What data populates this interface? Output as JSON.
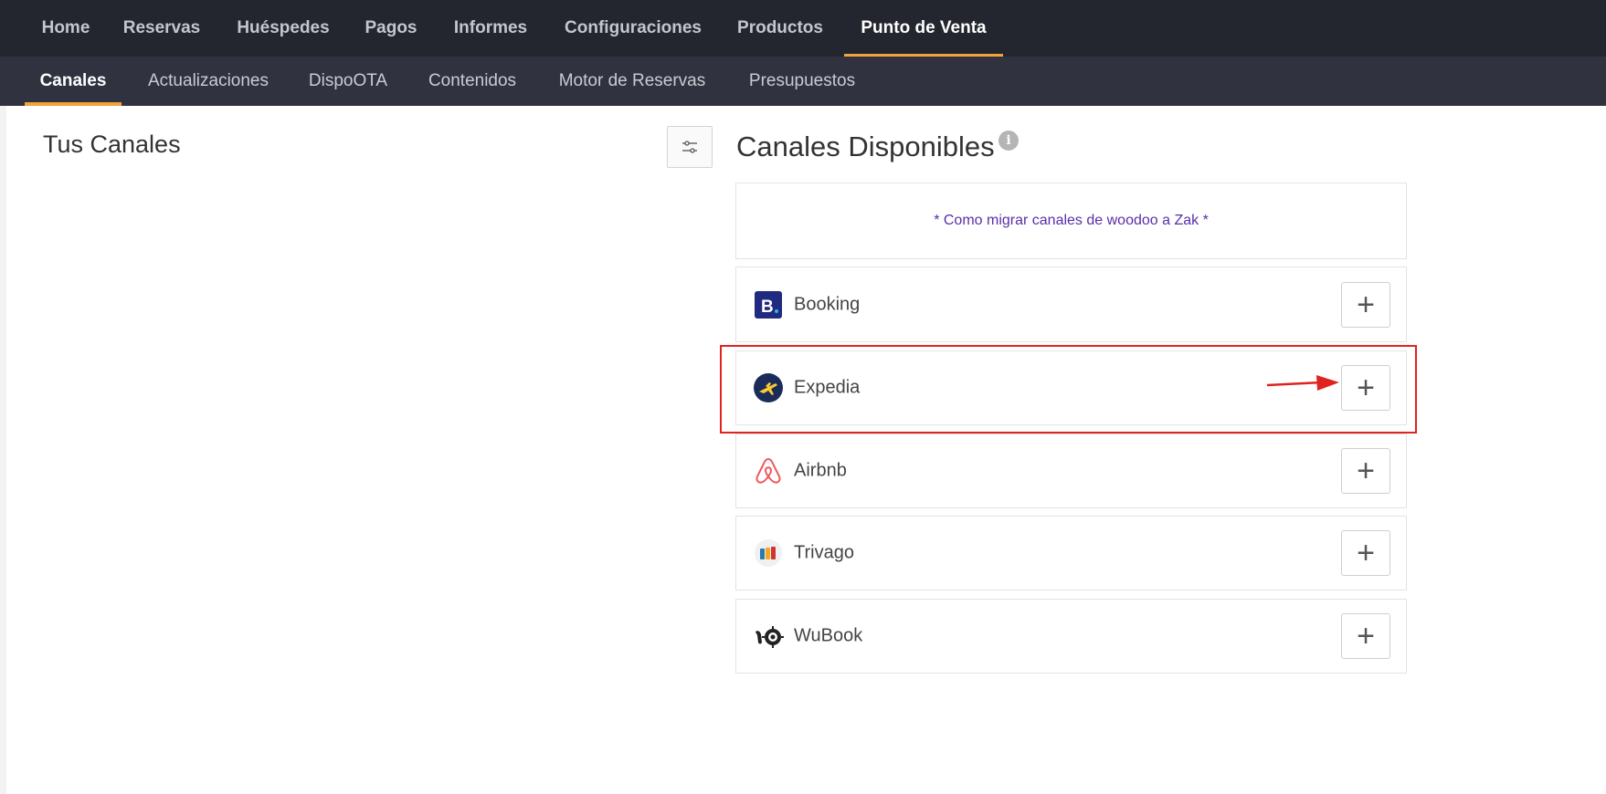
{
  "topnav": {
    "items": [
      {
        "label": "Home",
        "active": false
      },
      {
        "label": "Reservas",
        "active": false
      },
      {
        "label": "Huéspedes",
        "active": false
      },
      {
        "label": "Pagos",
        "active": false
      },
      {
        "label": "Informes",
        "active": false
      },
      {
        "label": "Configuraciones",
        "active": false
      },
      {
        "label": "Productos",
        "active": false
      },
      {
        "label": "Punto de Venta",
        "active": true
      }
    ]
  },
  "subnav": {
    "items": [
      {
        "label": "Canales",
        "active": true
      },
      {
        "label": "Actualizaciones",
        "active": false
      },
      {
        "label": "DispoOTA",
        "active": false
      },
      {
        "label": "Contenidos",
        "active": false
      },
      {
        "label": "Motor de Reservas",
        "active": false
      },
      {
        "label": "Presupuestos",
        "active": false
      }
    ]
  },
  "left": {
    "title": "Tus Canales"
  },
  "right": {
    "title": "Canales Disponibles",
    "migrate_link": "* Como migrar canales de woodoo a Zak *",
    "channels": [
      {
        "name": "Booking",
        "icon": "booking-logo-icon",
        "add": "+"
      },
      {
        "name": "Expedia",
        "icon": "expedia-logo-icon",
        "add": "+"
      },
      {
        "name": "Airbnb",
        "icon": "airbnb-logo-icon",
        "add": "+"
      },
      {
        "name": "Trivago",
        "icon": "trivago-logo-icon",
        "add": "+"
      },
      {
        "name": "WuBook",
        "icon": "wubook-logo-icon",
        "add": "+"
      }
    ]
  },
  "colors": {
    "topnav_bg": "#24262f",
    "subnav_bg": "#30333f",
    "accent": "#f2a33a",
    "link": "#5a2ea6",
    "annotation_red": "#e0231c"
  }
}
